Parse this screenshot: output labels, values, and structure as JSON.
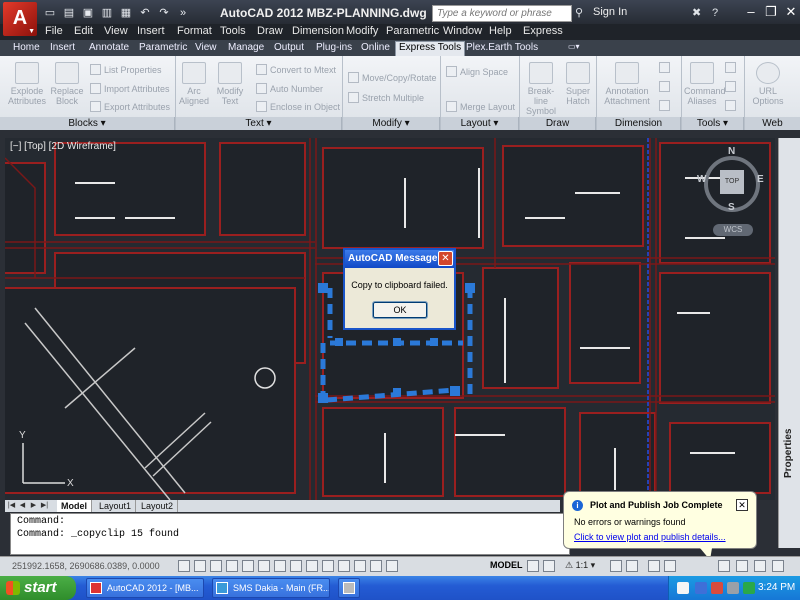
{
  "titlebar": {
    "app_logo_letter": "A",
    "title": "AutoCAD 2012    MBZ-PLANNING.dwg",
    "search_placeholder": "Type a keyword or phrase",
    "signin": "Sign In"
  },
  "menus": [
    "File",
    "Edit",
    "View",
    "Insert",
    "Format",
    "Tools",
    "Draw",
    "Dimension",
    "Modify",
    "Parametric",
    "Window",
    "Help",
    "Express"
  ],
  "ribbon_tabs": [
    "Home",
    "Insert",
    "Annotate",
    "Parametric",
    "View",
    "Manage",
    "Output",
    "Plug-ins",
    "Online",
    "Express Tools",
    "Plex.Earth Tools"
  ],
  "active_ribbon_tab": "Express Tools",
  "ribbon": {
    "blocks": {
      "title": "Blocks",
      "explode_attributes": "Explode Attributes",
      "replace_block": "Replace Block",
      "list_properties": "List Properties",
      "import_attributes": "Import Attributes",
      "export_attributes": "Export Attributes"
    },
    "text": {
      "title": "Text",
      "arc_aligned": "Arc Aligned",
      "modify_text": "Modify Text",
      "convert_to_mtext": "Convert to Mtext",
      "auto_number": "Auto Number",
      "enclose_in_object": "Enclose in Object"
    },
    "modify": {
      "title": "Modify",
      "move_copy_rotate": "Move/Copy/Rotate",
      "stretch_multiple": "Stretch Multiple"
    },
    "layout": {
      "title": "Layout",
      "align_space": "Align Space",
      "merge_layout": "Merge Layout"
    },
    "draw": {
      "title": "Draw",
      "break_line_symbol": "Break-line Symbol",
      "super_hatch": "Super Hatch"
    },
    "dimension": {
      "title": "Dimension",
      "annotation_attachment": "Annotation Attachment"
    },
    "tools": {
      "title": "Tools",
      "command_aliases": "Command Aliases"
    },
    "web": {
      "title": "Web",
      "url_options": "URL Options"
    }
  },
  "viewport_label": "[−] [Top] [2D Wireframe]",
  "viewcube": {
    "face": "TOP",
    "north": "N",
    "south": "S",
    "east": "E",
    "west": "W",
    "wcs": "WCS"
  },
  "properties_label": "Properties",
  "dialog": {
    "title": "AutoCAD Message",
    "message": "Copy to clipboard failed.",
    "ok": "OK"
  },
  "layout_tabs": [
    "Model",
    "Layout1",
    "Layout2"
  ],
  "active_layout_tab": "Model",
  "command_lines": [
    "Command:",
    "Command: _copyclip 15 found"
  ],
  "statusbar": {
    "coords": "251992.1658, 2690686.0389, 0.0000",
    "model": "MODEL",
    "scale": "1:1"
  },
  "balloon": {
    "title": "Plot and Publish Job Complete",
    "message": "No errors or warnings found",
    "link": "Click to view plot and publish details..."
  },
  "taskbar": {
    "start": "start",
    "tasks": [
      "AutoCAD 2012 - [MB...",
      "SMS Dakia - Main (FR...",
      ""
    ],
    "clock": "3:24 PM"
  },
  "colors": {
    "accent_red": "#c8202a",
    "road_red": "#8a1a1a",
    "selection_blue": "#2b79d8",
    "taskbar_blue": "#245cd4"
  }
}
